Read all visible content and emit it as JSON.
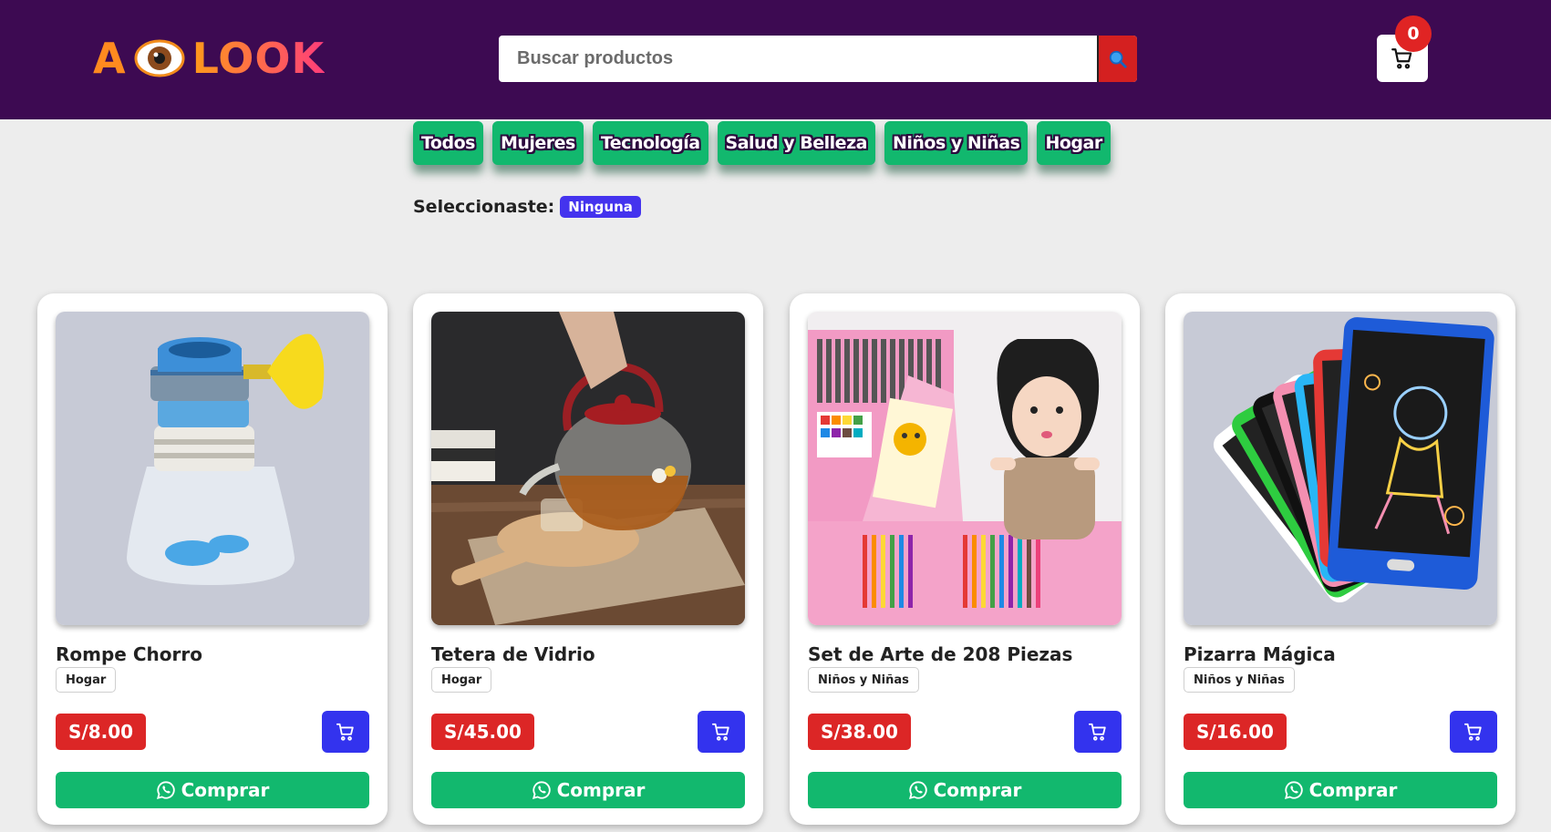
{
  "header": {
    "logo": {
      "left": "A",
      "right": "LOOK"
    },
    "search": {
      "placeholder": "Buscar productos"
    },
    "cart": {
      "count": "0"
    }
  },
  "categories": [
    "Todos",
    "Mujeres",
    "Tecnología",
    "Salud y Belleza",
    "Niños y Niñas",
    "Hogar"
  ],
  "selection": {
    "label": "Seleccionaste:",
    "value": "Ninguna"
  },
  "products": [
    {
      "name": "Rompe Chorro",
      "category": "Hogar",
      "price": "S/8.00",
      "buy_label": "Comprar"
    },
    {
      "name": "Tetera de Vidrio",
      "category": "Hogar",
      "price": "S/45.00",
      "buy_label": "Comprar"
    },
    {
      "name": "Set de Arte de 208 Piezas",
      "category": "Niños y Niñas",
      "price": "S/38.00",
      "buy_label": "Comprar"
    },
    {
      "name": "Pizarra Mágica",
      "category": "Niños y Niñas",
      "price": "S/16.00",
      "buy_label": "Comprar"
    }
  ],
  "colors": {
    "header_bg": "#3d0a52",
    "category_bg": "#12b86e",
    "price_bg": "#dc2626",
    "add_cart_bg": "#3333ee",
    "badge_bg": "#4433ee"
  },
  "icons": {
    "search": "search-icon",
    "cart": "cart-icon",
    "whatsapp": "whatsapp-icon"
  }
}
